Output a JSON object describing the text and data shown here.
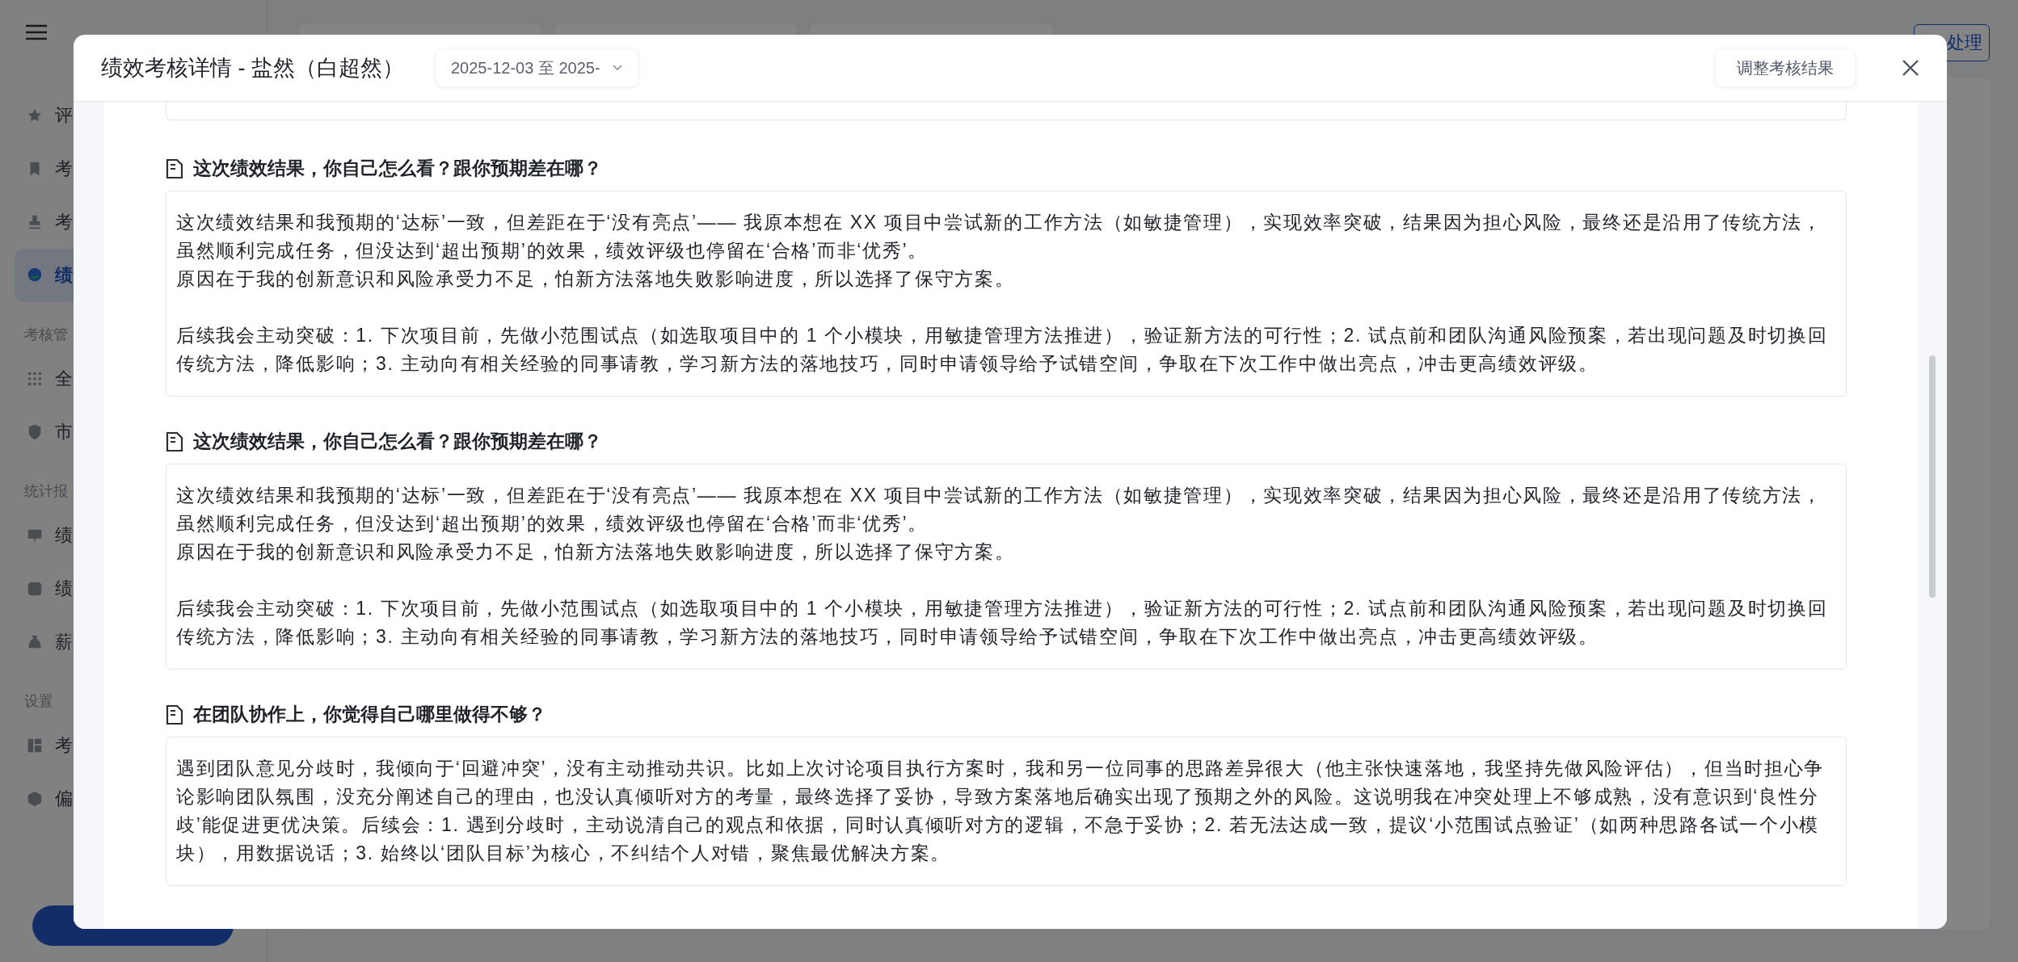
{
  "background": {
    "sidebar": {
      "groups": [
        {
          "items": [
            {
              "label": "评",
              "selected": false
            },
            {
              "label": "考",
              "selected": false
            },
            {
              "label": "考",
              "selected": false
            },
            {
              "label": "绩",
              "selected": true
            }
          ]
        },
        {
          "title": "考核管",
          "items": [
            {
              "label": "全",
              "selected": false
            },
            {
              "label": "市",
              "selected": false
            }
          ]
        },
        {
          "title": "统计报",
          "items": [
            {
              "label": "绩",
              "selected": false
            },
            {
              "label": "绩",
              "selected": false
            },
            {
              "label": "薪",
              "selected": false
            }
          ]
        },
        {
          "title": "设置",
          "items": [
            {
              "label": "考",
              "selected": false
            },
            {
              "label": "偏",
              "selected": false
            }
          ]
        }
      ]
    },
    "top_button": "处理"
  },
  "modal": {
    "title": "绩效考核详情 - 盐然（白超然）",
    "date_range": "2025-12-03 至 2025-",
    "adjust_button": "调整考核结果",
    "sections": [
      {
        "question": "这次绩效结果，你自己怎么看？跟你预期差在哪？",
        "answer_blocks": [
          [
            "这次绩效结果和我预期的‘达标’一致，但差距在于‘没有亮点’—— 我原本想在 XX 项目中尝试新的工作方法（如敏捷管理），实现效率突破，结果因为担心风险，最终还是沿用了传统方法，虽然顺利完成任务，但没达到‘超出预期’的效果，绩效评级也停留在‘合格’而非‘优秀’。",
            "原因在于我的创新意识和风险承受力不足，怕新方法落地失败影响进度，所以选择了保守方案。"
          ],
          [
            "后续我会主动突破：1. 下次项目前，先做小范围试点（如选取项目中的 1 个小模块，用敏捷管理方法推进），验证新方法的可行性；2. 试点前和团队沟通风险预案，若出现问题及时切换回传统方法，降低影响；3. 主动向有相关经验的同事请教，学习新方法的落地技巧，同时申请领导给予试错空间，争取在下次工作中做出亮点，冲击更高绩效评级。"
          ]
        ]
      },
      {
        "question": "这次绩效结果，你自己怎么看？跟你预期差在哪？",
        "answer_blocks": [
          [
            "这次绩效结果和我预期的‘达标’一致，但差距在于‘没有亮点’—— 我原本想在 XX 项目中尝试新的工作方法（如敏捷管理），实现效率突破，结果因为担心风险，最终还是沿用了传统方法，虽然顺利完成任务，但没达到‘超出预期’的效果，绩效评级也停留在‘合格’而非‘优秀’。",
            "原因在于我的创新意识和风险承受力不足，怕新方法落地失败影响进度，所以选择了保守方案。"
          ],
          [
            "后续我会主动突破：1. 下次项目前，先做小范围试点（如选取项目中的 1 个小模块，用敏捷管理方法推进），验证新方法的可行性；2. 试点前和团队沟通风险预案，若出现问题及时切换回传统方法，降低影响；3. 主动向有相关经验的同事请教，学习新方法的落地技巧，同时申请领导给予试错空间，争取在下次工作中做出亮点，冲击更高绩效评级。"
          ]
        ]
      },
      {
        "question": "在团队协作上，你觉得自己哪里做得不够？",
        "answer_blocks": [
          [
            "遇到团队意见分歧时，我倾向于‘回避冲突’，没有主动推动共识。比如上次讨论项目执行方案时，我和另一位同事的思路差异很大（他主张快速落地，我坚持先做风险评估），但当时担心争论影响团队氛围，没充分阐述自己的理由，也没认真倾听对方的考量，最终选择了妥协，导致方案落地后确实出现了预期之外的风险。这说明我在冲突处理上不够成熟，没有意识到‘良性分歧’能促进更优决策。后续会：1. 遇到分歧时，主动说清自己的观点和依据，同时认真倾听对方的逻辑，不急于妥协；2. 若无法达成一致，提议‘小范围试点验证’（如两种思路各试一个小模块），用数据说话；3. 始终以‘团队目标’为核心，不纠结个人对错，聚焦最优解决方案。"
          ]
        ]
      }
    ]
  }
}
